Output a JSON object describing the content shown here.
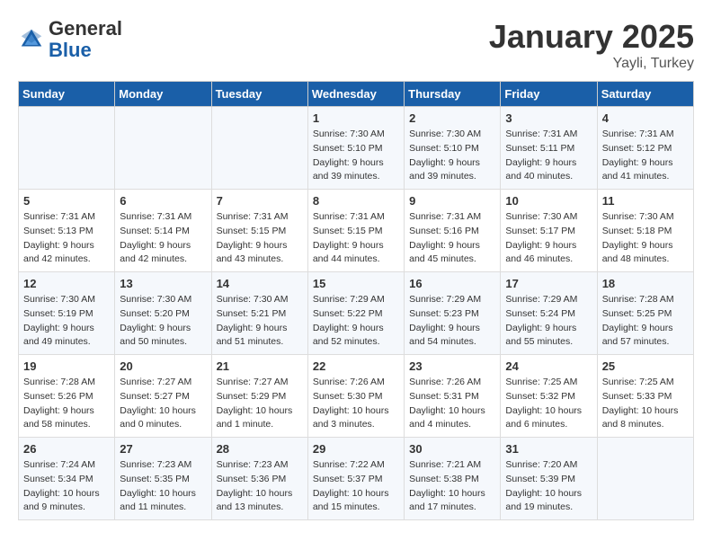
{
  "header": {
    "logo_general": "General",
    "logo_blue": "Blue",
    "month": "January 2025",
    "location": "Yayli, Turkey"
  },
  "weekdays": [
    "Sunday",
    "Monday",
    "Tuesday",
    "Wednesday",
    "Thursday",
    "Friday",
    "Saturday"
  ],
  "weeks": [
    [
      {
        "num": "",
        "info": ""
      },
      {
        "num": "",
        "info": ""
      },
      {
        "num": "",
        "info": ""
      },
      {
        "num": "1",
        "info": "Sunrise: 7:30 AM\nSunset: 5:10 PM\nDaylight: 9 hours\nand 39 minutes."
      },
      {
        "num": "2",
        "info": "Sunrise: 7:30 AM\nSunset: 5:10 PM\nDaylight: 9 hours\nand 39 minutes."
      },
      {
        "num": "3",
        "info": "Sunrise: 7:31 AM\nSunset: 5:11 PM\nDaylight: 9 hours\nand 40 minutes."
      },
      {
        "num": "4",
        "info": "Sunrise: 7:31 AM\nSunset: 5:12 PM\nDaylight: 9 hours\nand 41 minutes."
      }
    ],
    [
      {
        "num": "5",
        "info": "Sunrise: 7:31 AM\nSunset: 5:13 PM\nDaylight: 9 hours\nand 42 minutes."
      },
      {
        "num": "6",
        "info": "Sunrise: 7:31 AM\nSunset: 5:14 PM\nDaylight: 9 hours\nand 42 minutes."
      },
      {
        "num": "7",
        "info": "Sunrise: 7:31 AM\nSunset: 5:15 PM\nDaylight: 9 hours\nand 43 minutes."
      },
      {
        "num": "8",
        "info": "Sunrise: 7:31 AM\nSunset: 5:15 PM\nDaylight: 9 hours\nand 44 minutes."
      },
      {
        "num": "9",
        "info": "Sunrise: 7:31 AM\nSunset: 5:16 PM\nDaylight: 9 hours\nand 45 minutes."
      },
      {
        "num": "10",
        "info": "Sunrise: 7:30 AM\nSunset: 5:17 PM\nDaylight: 9 hours\nand 46 minutes."
      },
      {
        "num": "11",
        "info": "Sunrise: 7:30 AM\nSunset: 5:18 PM\nDaylight: 9 hours\nand 48 minutes."
      }
    ],
    [
      {
        "num": "12",
        "info": "Sunrise: 7:30 AM\nSunset: 5:19 PM\nDaylight: 9 hours\nand 49 minutes."
      },
      {
        "num": "13",
        "info": "Sunrise: 7:30 AM\nSunset: 5:20 PM\nDaylight: 9 hours\nand 50 minutes."
      },
      {
        "num": "14",
        "info": "Sunrise: 7:30 AM\nSunset: 5:21 PM\nDaylight: 9 hours\nand 51 minutes."
      },
      {
        "num": "15",
        "info": "Sunrise: 7:29 AM\nSunset: 5:22 PM\nDaylight: 9 hours\nand 52 minutes."
      },
      {
        "num": "16",
        "info": "Sunrise: 7:29 AM\nSunset: 5:23 PM\nDaylight: 9 hours\nand 54 minutes."
      },
      {
        "num": "17",
        "info": "Sunrise: 7:29 AM\nSunset: 5:24 PM\nDaylight: 9 hours\nand 55 minutes."
      },
      {
        "num": "18",
        "info": "Sunrise: 7:28 AM\nSunset: 5:25 PM\nDaylight: 9 hours\nand 57 minutes."
      }
    ],
    [
      {
        "num": "19",
        "info": "Sunrise: 7:28 AM\nSunset: 5:26 PM\nDaylight: 9 hours\nand 58 minutes."
      },
      {
        "num": "20",
        "info": "Sunrise: 7:27 AM\nSunset: 5:27 PM\nDaylight: 10 hours\nand 0 minutes."
      },
      {
        "num": "21",
        "info": "Sunrise: 7:27 AM\nSunset: 5:29 PM\nDaylight: 10 hours\nand 1 minute."
      },
      {
        "num": "22",
        "info": "Sunrise: 7:26 AM\nSunset: 5:30 PM\nDaylight: 10 hours\nand 3 minutes."
      },
      {
        "num": "23",
        "info": "Sunrise: 7:26 AM\nSunset: 5:31 PM\nDaylight: 10 hours\nand 4 minutes."
      },
      {
        "num": "24",
        "info": "Sunrise: 7:25 AM\nSunset: 5:32 PM\nDaylight: 10 hours\nand 6 minutes."
      },
      {
        "num": "25",
        "info": "Sunrise: 7:25 AM\nSunset: 5:33 PM\nDaylight: 10 hours\nand 8 minutes."
      }
    ],
    [
      {
        "num": "26",
        "info": "Sunrise: 7:24 AM\nSunset: 5:34 PM\nDaylight: 10 hours\nand 9 minutes."
      },
      {
        "num": "27",
        "info": "Sunrise: 7:23 AM\nSunset: 5:35 PM\nDaylight: 10 hours\nand 11 minutes."
      },
      {
        "num": "28",
        "info": "Sunrise: 7:23 AM\nSunset: 5:36 PM\nDaylight: 10 hours\nand 13 minutes."
      },
      {
        "num": "29",
        "info": "Sunrise: 7:22 AM\nSunset: 5:37 PM\nDaylight: 10 hours\nand 15 minutes."
      },
      {
        "num": "30",
        "info": "Sunrise: 7:21 AM\nSunset: 5:38 PM\nDaylight: 10 hours\nand 17 minutes."
      },
      {
        "num": "31",
        "info": "Sunrise: 7:20 AM\nSunset: 5:39 PM\nDaylight: 10 hours\nand 19 minutes."
      },
      {
        "num": "",
        "info": ""
      }
    ]
  ]
}
